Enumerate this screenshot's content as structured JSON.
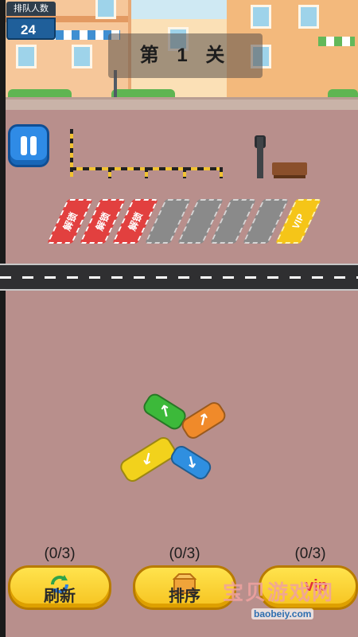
{
  "queue": {
    "label": "排队人数",
    "count": "24"
  },
  "level": {
    "title": "第 1 关"
  },
  "pause": {
    "icon": "pause-icon"
  },
  "slots": [
    {
      "state": "locked",
      "label": "解锁"
    },
    {
      "state": "locked",
      "label": "解锁"
    },
    {
      "state": "locked",
      "label": "解锁"
    },
    {
      "state": "empty",
      "label": ""
    },
    {
      "state": "empty",
      "label": ""
    },
    {
      "state": "empty",
      "label": ""
    },
    {
      "state": "empty",
      "label": ""
    },
    {
      "state": "vip",
      "label": "VIP"
    }
  ],
  "cars": [
    {
      "color": "#3cb93a",
      "direction": "up-left",
      "arrow": "↖"
    },
    {
      "color": "#f08a2a",
      "direction": "up-right",
      "arrow": "↗"
    },
    {
      "color": "#f2d21c",
      "direction": "down-left",
      "arrow": "↙"
    },
    {
      "color": "#2f8fe0",
      "direction": "down-right",
      "arrow": "↘"
    }
  ],
  "actions": {
    "refresh": {
      "count": "(0/3)",
      "label": "刷新",
      "icon": "refresh-icon"
    },
    "sort": {
      "count": "(0/3)",
      "label": "排序",
      "icon": "box-icon"
    },
    "third": {
      "count": "(0/3)",
      "label": "",
      "icon": "vip-icon"
    }
  },
  "watermark": {
    "text": "宝贝游戏网",
    "url": "baobeiy.com"
  },
  "colors": {
    "ground": "#b88f8c",
    "button": "#f6c320",
    "pause": "#2f8be6"
  }
}
